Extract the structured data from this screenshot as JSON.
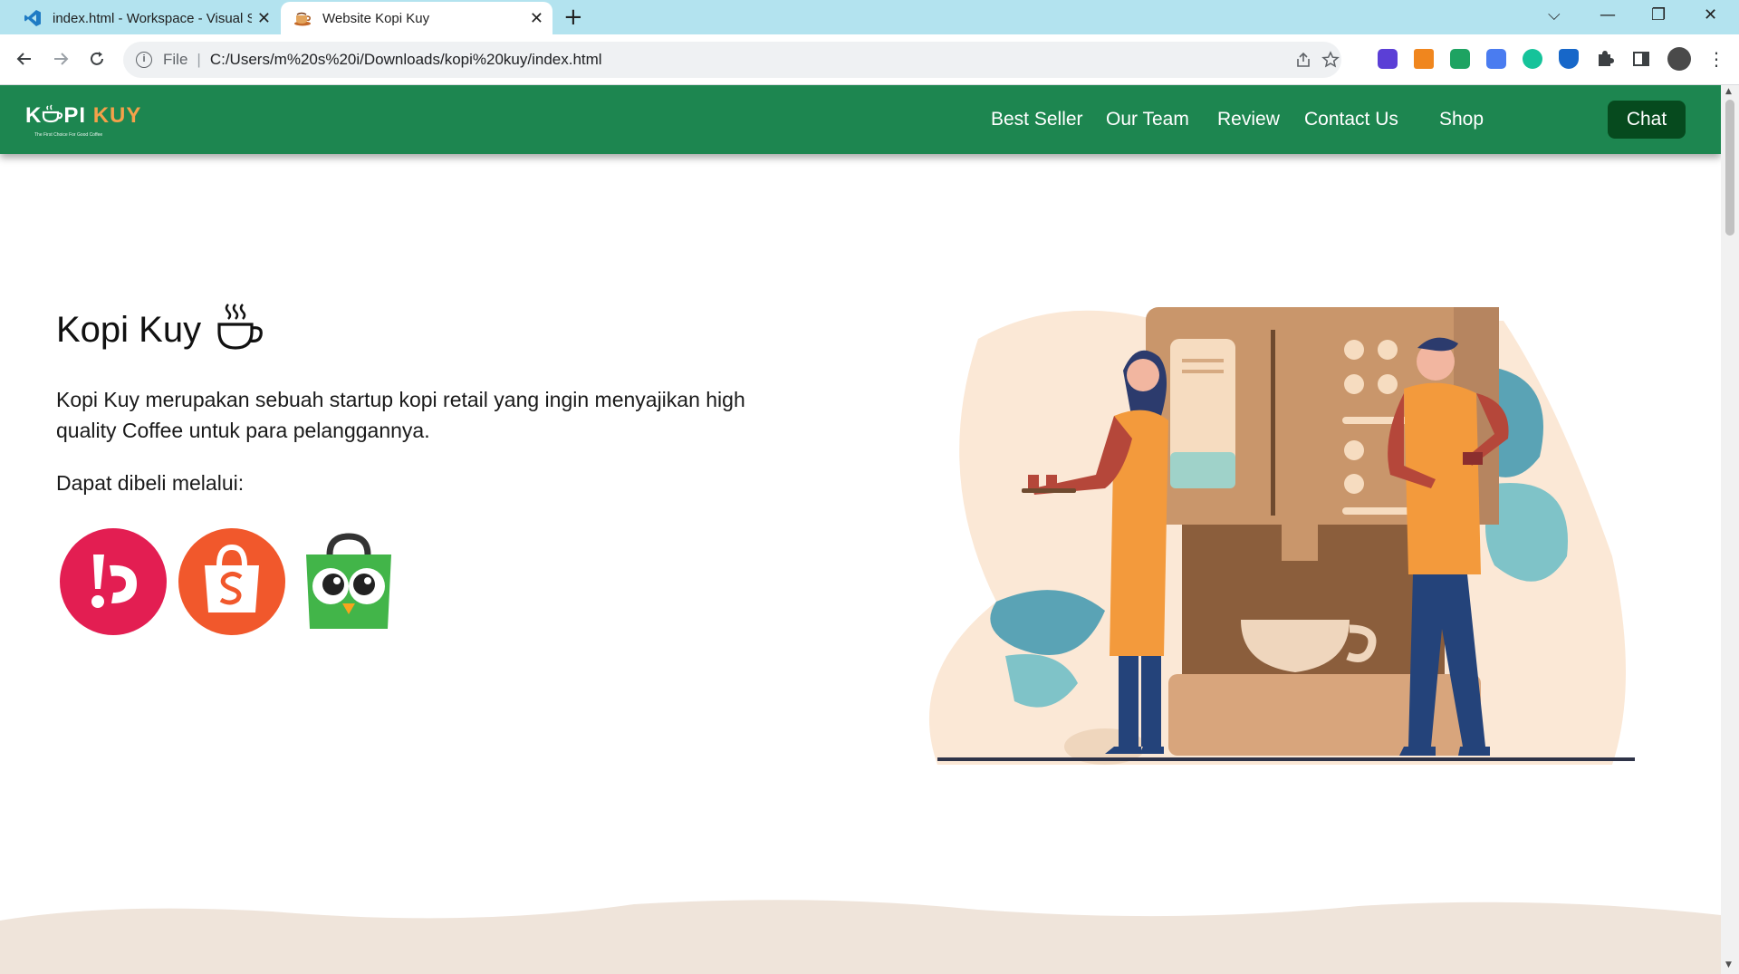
{
  "browser": {
    "tabs": [
      {
        "title": "index.html - Workspace - Visual Studio Code",
        "icon": "vscode-icon",
        "active": false
      },
      {
        "title": "Website Kopi Kuy",
        "icon": "coffee-cup-icon",
        "active": true
      }
    ],
    "new_tab": "+",
    "close": "✕",
    "address": {
      "scheme": "File",
      "url": "C:/Users/m%20s%20i/Downloads/kopi%20kuy/index.html"
    },
    "window_controls": {
      "tab_search": "⌵",
      "minimize": "—",
      "restore": "❐",
      "close": "✕"
    }
  },
  "site": {
    "logo": {
      "part1": "K",
      "part2": "PI",
      "part3": "KUY",
      "tagline": "The First Choice For Good Coffee"
    },
    "nav": [
      "Best Seller",
      "Our Team",
      "Review",
      "Contact Us",
      "Shop"
    ],
    "chat_label": "Chat",
    "hero": {
      "title": "Kopi Kuy",
      "description": "Kopi Kuy merupakan sebuah startup kopi retail yang ingin menyajikan high quality Coffee untuk para pelanggannya.",
      "buy_label": "Dapat dibeli melalui:",
      "stores": [
        "Bukalapak",
        "Shopee",
        "Tokopedia"
      ]
    }
  },
  "colors": {
    "navbar": "#1d8650",
    "chat_button": "#064a1e",
    "accent_orange": "#f5a14a",
    "bukalapak": "#e31e52",
    "shopee": "#f1582c",
    "tokopedia": "#42b549",
    "wave": "#efe4da"
  }
}
